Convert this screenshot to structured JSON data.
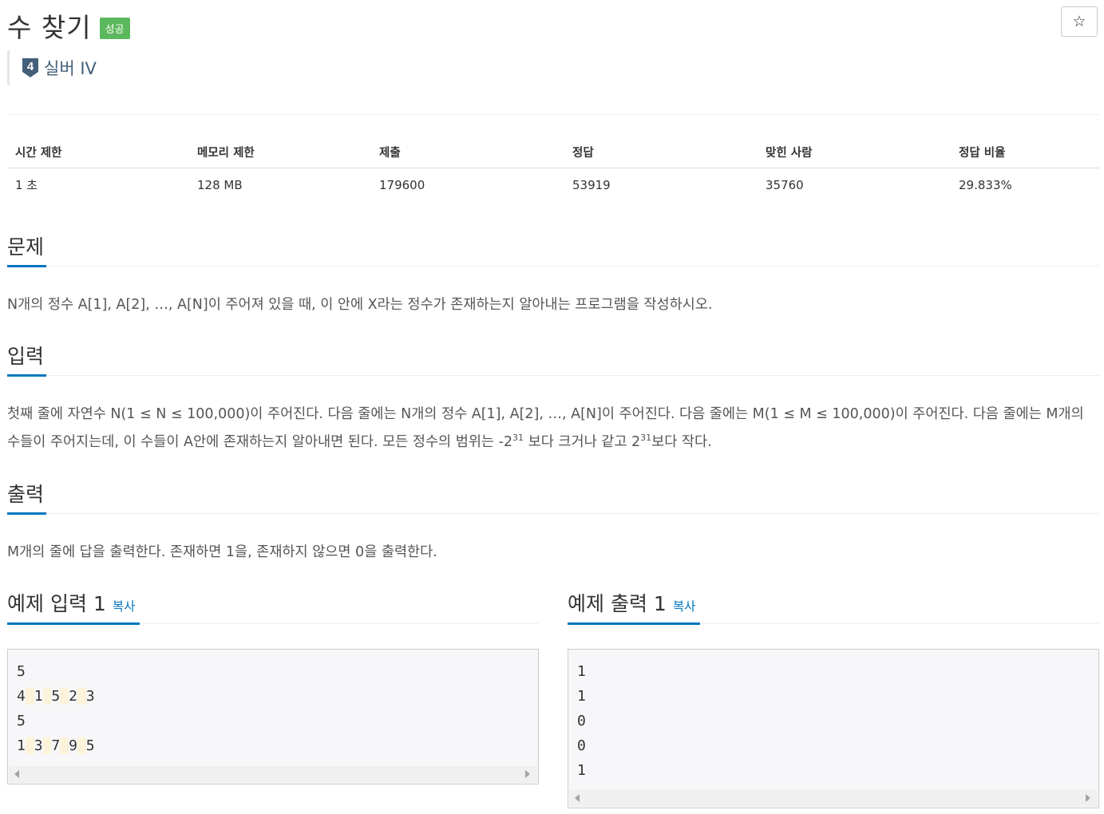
{
  "problem": {
    "title": "수 찾기",
    "status_badge": "성공",
    "star_icon": "☆",
    "tier_number": "4",
    "tier_label": "실버 IV"
  },
  "info_table": {
    "headers": [
      "시간 제한",
      "메모리 제한",
      "제출",
      "정답",
      "맞힌 사람",
      "정답 비율"
    ],
    "values": [
      "1 초",
      "128 MB",
      "179600",
      "53919",
      "35760",
      "29.833%"
    ]
  },
  "sections": {
    "problem_title": "문제",
    "problem_text": "N개의 정수 A[1], A[2], …, A[N]이 주어져 있을 때, 이 안에 X라는 정수가 존재하는지 알아내는 프로그램을 작성하시오.",
    "input_title": "입력",
    "input_text_1": "첫째 줄에 자연수 N(1 ≤ N ≤ 100,000)이 주어진다. 다음 줄에는 N개의 정수 A[1], A[2], …, A[N]이 주어진다. 다음 줄에는 M(1 ≤ M ≤ 100,000)이 주어진다. 다음 줄에는 M개의 수들이 주어지는데, 이 수들이 A안에 존재하는지 알아내면 된다. 모든 정수의 범위는 -2",
    "input_exp_1": "31",
    "input_text_2": " 보다 크거나 같고 2",
    "input_exp_2": "31",
    "input_text_3": "보다 작다.",
    "output_title": "출력",
    "output_text": "M개의 줄에 답을 출력한다. 존재하면 1을, 존재하지 않으면 0을 출력한다."
  },
  "examples": {
    "input_title": "예제 입력 1",
    "output_title": "예제 출력 1",
    "copy_label": "복사",
    "input_lines": [
      [
        "5"
      ],
      [
        "4",
        "1",
        "5",
        "2",
        "3"
      ],
      [
        "5"
      ],
      [
        "1",
        "3",
        "7",
        "9",
        "5"
      ]
    ],
    "output_lines": [
      "1",
      "1",
      "0",
      "0",
      "1"
    ]
  },
  "colors": {
    "badge_success": "#5cb85c",
    "link_blue": "#0076c0",
    "tier_silver": "#435f7a"
  }
}
